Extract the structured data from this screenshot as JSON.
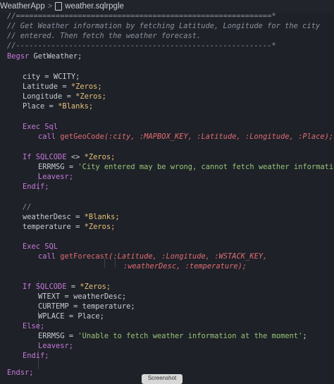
{
  "breadcrumb": {
    "folder": "WeatherApp",
    "file": "weather.sqlrpgle"
  },
  "tooltip": "Screenshot",
  "code": {
    "divider1": "//==========================================================*",
    "comment1": "// Get Weather information by fetching Latitude, Longitude for the city",
    "comment2": "// entered. Then fetch the weather forecast.",
    "divider2": "//----------------------------------------------------------*",
    "begsr": "Begsr",
    "subr_name": "GetWeather;",
    "v_city": "city",
    "v_wcity": "WCITY;",
    "v_latitude": "Latitude",
    "v_longitude": "Longitude",
    "v_place": "Place",
    "eq": "=",
    "zeros": "*Zeros;",
    "blanks": "*Blanks;",
    "exec": "Exec",
    "sql": "Sql",
    "sql_upper": "SQL",
    "call": "call",
    "getgeocode": "getGeoCode",
    "geo_args": "(:city, :MAPBOX_KEY, :Latitude, :Longitude, :Place);",
    "if": "If",
    "sqlcode": "SQLCODE",
    "ne": "<>",
    "errmsg": "ERRMSG",
    "err1": "'City entered may be wrong, cannot fetch weather information'",
    "semi": ";",
    "leavesr": "Leavesr;",
    "endif": "Endif;",
    "comment3": "//",
    "weatherdesc": "weatherDesc",
    "temperature": "temperature",
    "getforecast": "getForecast",
    "fc_args1": "(:Latitude, :Longitude, :WSTACK_KEY,",
    "fc_args2": ":weatherDesc, :temperature);",
    "wtext": "WTEXT",
    "weatherdesc_semi": "weatherDesc;",
    "curtemp": "CURTEMP",
    "temperature_semi": "temperature;",
    "wplace": "WPLACE",
    "place_semi": "Place;",
    "else": "Else;",
    "err2": "'Unable to fetch weather information at the moment'",
    "endsr": "Endsr;"
  }
}
